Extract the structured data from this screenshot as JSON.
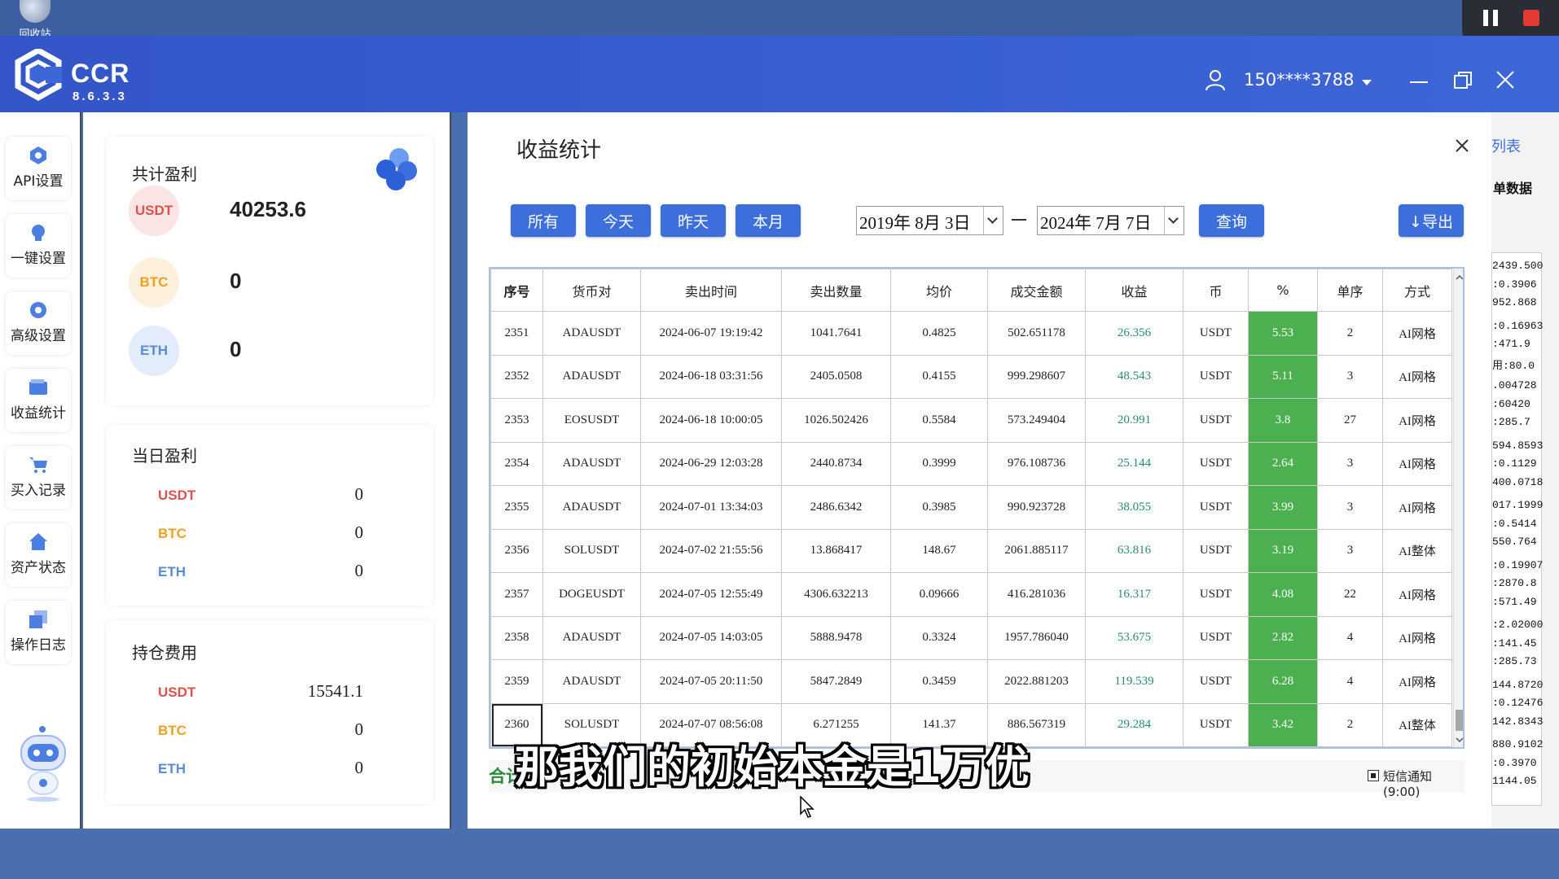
{
  "desktop": {
    "icon_label": "回收站"
  },
  "app": {
    "name": "CCR",
    "version": "8.6.3.3"
  },
  "user": {
    "phone": "150****3788"
  },
  "nav": {
    "items": [
      {
        "label": "API设置",
        "icon": "api-icon"
      },
      {
        "label": "一键设置",
        "icon": "bulb-icon"
      },
      {
        "label": "高级设置",
        "icon": "gear-icon"
      },
      {
        "label": "收益统计",
        "icon": "wallet-icon"
      },
      {
        "label": "买入记录",
        "icon": "cart-icon"
      },
      {
        "label": "资产状态",
        "icon": "home-icon"
      },
      {
        "label": "操作日志",
        "icon": "log-icon"
      }
    ]
  },
  "stats": {
    "total": {
      "title": "共计盈利",
      "usdt_label": "USDT",
      "usdt": "40253.6",
      "btc_label": "BTC",
      "btc": "0",
      "eth_label": "ETH",
      "eth": "0"
    },
    "daily": {
      "title": "当日盈利",
      "usdt_label": "USDT",
      "usdt": "0",
      "btc_label": "BTC",
      "btc": "0",
      "eth_label": "ETH",
      "eth": "0"
    },
    "position": {
      "title": "持仓费用",
      "usdt_label": "USDT",
      "usdt": "15541.1",
      "btc_label": "BTC",
      "btc": "0",
      "eth_label": "ETH",
      "eth": "0"
    }
  },
  "modal": {
    "title": "收益统计",
    "filters": {
      "all": "所有",
      "today": "今天",
      "yesterday": "昨天",
      "month": "本月"
    },
    "date_from": "2019年 8月 3日",
    "date_to": "2024年 7月 7日",
    "query": "查询",
    "export": "↓导出",
    "columns": [
      "序号",
      "货币对",
      "卖出时间",
      "卖出数量",
      "均价",
      "成交金额",
      "收益",
      "币",
      "%",
      "单序",
      "方式"
    ],
    "rows": [
      [
        "2351",
        "ADAUSDT",
        "2024-06-07 19:19:42",
        "1041.7641",
        "0.4825",
        "502.651178",
        "26.356",
        "USDT",
        "5.53",
        "2",
        "AI网格"
      ],
      [
        "2352",
        "ADAUSDT",
        "2024-06-18 03:31:56",
        "2405.0508",
        "0.4155",
        "999.298607",
        "48.543",
        "USDT",
        "5.11",
        "3",
        "AI网格"
      ],
      [
        "2353",
        "EOSUSDT",
        "2024-06-18 10:00:05",
        "1026.502426",
        "0.5584",
        "573.249404",
        "20.991",
        "USDT",
        "3.8",
        "27",
        "AI网格"
      ],
      [
        "2354",
        "ADAUSDT",
        "2024-06-29 12:03:28",
        "2440.8734",
        "0.3999",
        "976.108736",
        "25.144",
        "USDT",
        "2.64",
        "3",
        "AI网格"
      ],
      [
        "2355",
        "ADAUSDT",
        "2024-07-01 13:34:03",
        "2486.6342",
        "0.3985",
        "990.923728",
        "38.055",
        "USDT",
        "3.99",
        "3",
        "AI网格"
      ],
      [
        "2356",
        "SOLUSDT",
        "2024-07-02 21:55:56",
        "13.868417",
        "148.67",
        "2061.885117",
        "63.816",
        "USDT",
        "3.19",
        "3",
        "AI整体"
      ],
      [
        "2357",
        "DOGEUSDT",
        "2024-07-05 12:55:49",
        "4306.632213",
        "0.09666",
        "416.281036",
        "16.317",
        "USDT",
        "4.08",
        "22",
        "AI网格"
      ],
      [
        "2358",
        "ADAUSDT",
        "2024-07-05 14:03:05",
        "5888.9478",
        "0.3324",
        "1957.786040",
        "53.675",
        "USDT",
        "2.82",
        "4",
        "AI网格"
      ],
      [
        "2359",
        "ADAUSDT",
        "2024-07-05 20:11:50",
        "5847.2849",
        "0.3459",
        "2022.881203",
        "119.539",
        "USDT",
        "6.28",
        "4",
        "AI网格"
      ],
      [
        "2360",
        "SOLUSDT",
        "2024-07-07 08:56:08",
        "6.271255",
        "141.37",
        "886.567319",
        "29.284",
        "USDT",
        "3.42",
        "2",
        "AI整体"
      ]
    ],
    "total_label": "合计",
    "sms_label": "短信通知(9:00)"
  },
  "right_window": {
    "header1": "列表",
    "header2": "单数据",
    "lines": [
      "2439.500",
      ":0.3906",
      "952.868",
      ":0.16963",
      ":471.9",
      "用:80.0",
      ".004728",
      ":60420",
      ":285.7",
      "594.8593",
      ":0.1129",
      "400.0718",
      "017.1999",
      ":0.5414",
      "550.764",
      ":0.19907",
      ":2870.8",
      ":571.49",
      ":2.02000",
      ":141.45",
      ":285.73",
      "144.8720",
      ":0.12476",
      "142.8343",
      "880.9102",
      ":0.3970",
      "1144.05"
    ]
  },
  "subtitle": "那我们的初始本金是1万优",
  "colors": {
    "brand_blue": "#3d6fdc",
    "profit_green": "#2d8a6e",
    "pct_bg": "#4caf50",
    "usdt": "#d9534f",
    "btc": "#f0a020",
    "eth": "#5b8ad6"
  }
}
